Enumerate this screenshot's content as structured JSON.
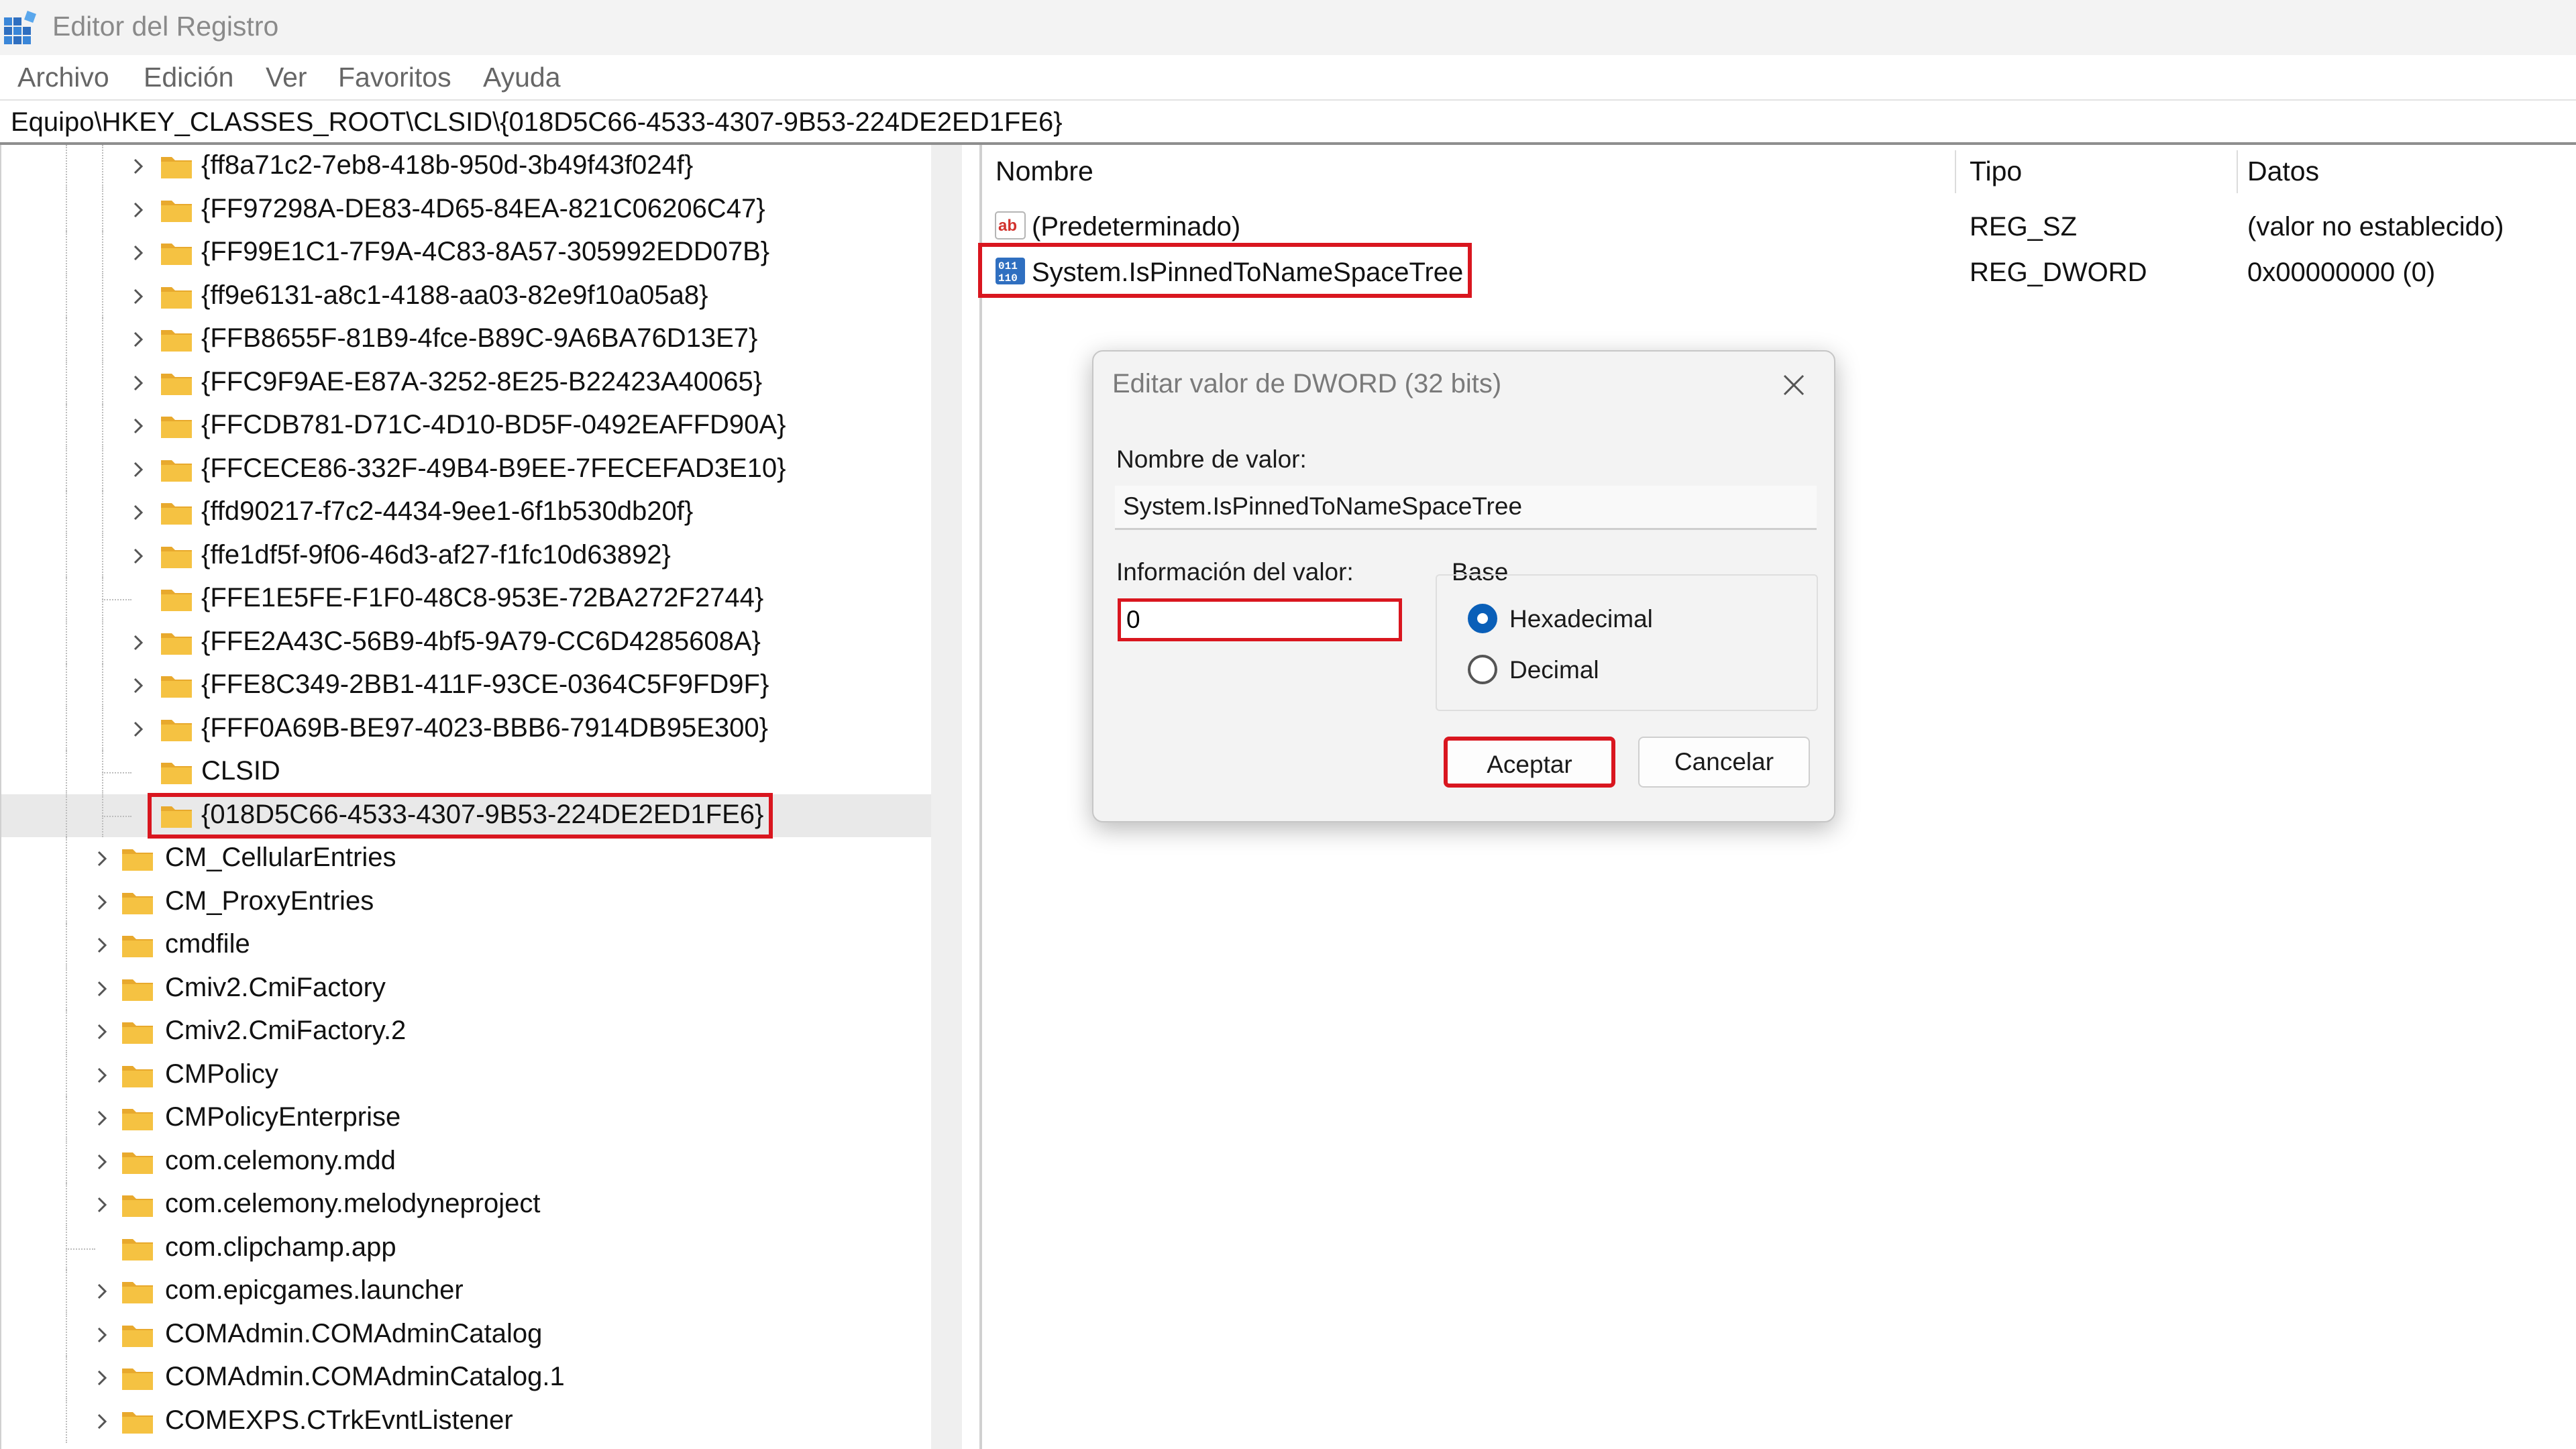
{
  "window": {
    "title": "Editor del Registro"
  },
  "menu": [
    "Archivo",
    "Edición",
    "Ver",
    "Favoritos",
    "Ayuda"
  ],
  "address": "Equipo\\HKEY_CLASSES_ROOT\\CLSID\\{018D5C66-4533-4307-9B53-224DE2ED1FE6}",
  "tree": [
    {
      "label": "{ff8a71c2-7eb8-418b-950d-3b49f43f024f}"
    },
    {
      "label": "{FF97298A-DE83-4D65-84EA-821C06206C47}"
    },
    {
      "label": "{FF99E1C1-7F9A-4C83-8A57-305992EDD07B}"
    },
    {
      "label": "{ff9e6131-a8c1-4188-aa03-82e9f10a05a8}"
    },
    {
      "label": "{FFB8655F-81B9-4fce-B89C-9A6BA76D13E7}"
    },
    {
      "label": "{FFC9F9AE-E87A-3252-8E25-B22423A40065}"
    },
    {
      "label": "{FFCDB781-D71C-4D10-BD5F-0492EAFFD90A}"
    },
    {
      "label": "{FFCECE86-332F-49B4-B9EE-7FECEFAD3E10}"
    },
    {
      "label": "{ffd90217-f7c2-4434-9ee1-6f1b530db20f}"
    },
    {
      "label": "{ffe1df5f-9f06-46d3-af27-f1fc10d63892}"
    },
    {
      "label": "{FFE1E5FE-F1F0-48C8-953E-72BA272F2744}"
    },
    {
      "label": "{FFE2A43C-56B9-4bf5-9A79-CC6D4285608A}"
    },
    {
      "label": "{FFE8C349-2BB1-411F-93CE-0364C5F9FD9F}"
    },
    {
      "label": "{FFF0A69B-BE97-4023-BBB6-7914DB95E300}"
    },
    {
      "label": "CLSID"
    },
    {
      "label": "{018D5C66-4533-4307-9B53-224DE2ED1FE6}"
    },
    {
      "label": "CM_CellularEntries"
    },
    {
      "label": "CM_ProxyEntries"
    },
    {
      "label": "cmdfile"
    },
    {
      "label": "Cmiv2.CmiFactory"
    },
    {
      "label": "Cmiv2.CmiFactory.2"
    },
    {
      "label": "CMPolicy"
    },
    {
      "label": "CMPolicyEnterprise"
    },
    {
      "label": "com.celemony.mdd"
    },
    {
      "label": "com.celemony.melodyneproject"
    },
    {
      "label": "com.clipchamp.app"
    },
    {
      "label": "com.epicgames.launcher"
    },
    {
      "label": "COMAdmin.COMAdminCatalog"
    },
    {
      "label": "COMAdmin.COMAdminCatalog.1"
    },
    {
      "label": "COMEXPS.CTrkEvntListener"
    }
  ],
  "values": {
    "headers": [
      "Nombre",
      "Tipo",
      "Datos"
    ],
    "rows": [
      {
        "name": "(Predeterminado)",
        "type": "REG_SZ",
        "data": "(valor no establecido)",
        "icon": "string-value-icon"
      },
      {
        "name": "System.IsPinnedToNameSpaceTree",
        "type": "REG_DWORD",
        "data": "0x00000000 (0)",
        "icon": "binary-value-icon"
      }
    ]
  },
  "dialog": {
    "title": "Editar valor de DWORD (32 bits)",
    "name_label": "Nombre de valor:",
    "name_value": "System.IsPinnedToNameSpaceTree",
    "data_label": "Información del valor:",
    "data_value": "0",
    "base_label": "Base",
    "base_options": [
      "Hexadecimal",
      "Decimal"
    ],
    "base_selected": "Hexadecimal",
    "ok_label": "Aceptar",
    "cancel_label": "Cancelar"
  },
  "colors": {
    "highlight": "#d9161f",
    "folder": "#f5c242",
    "accent": "#0a5fb8"
  }
}
